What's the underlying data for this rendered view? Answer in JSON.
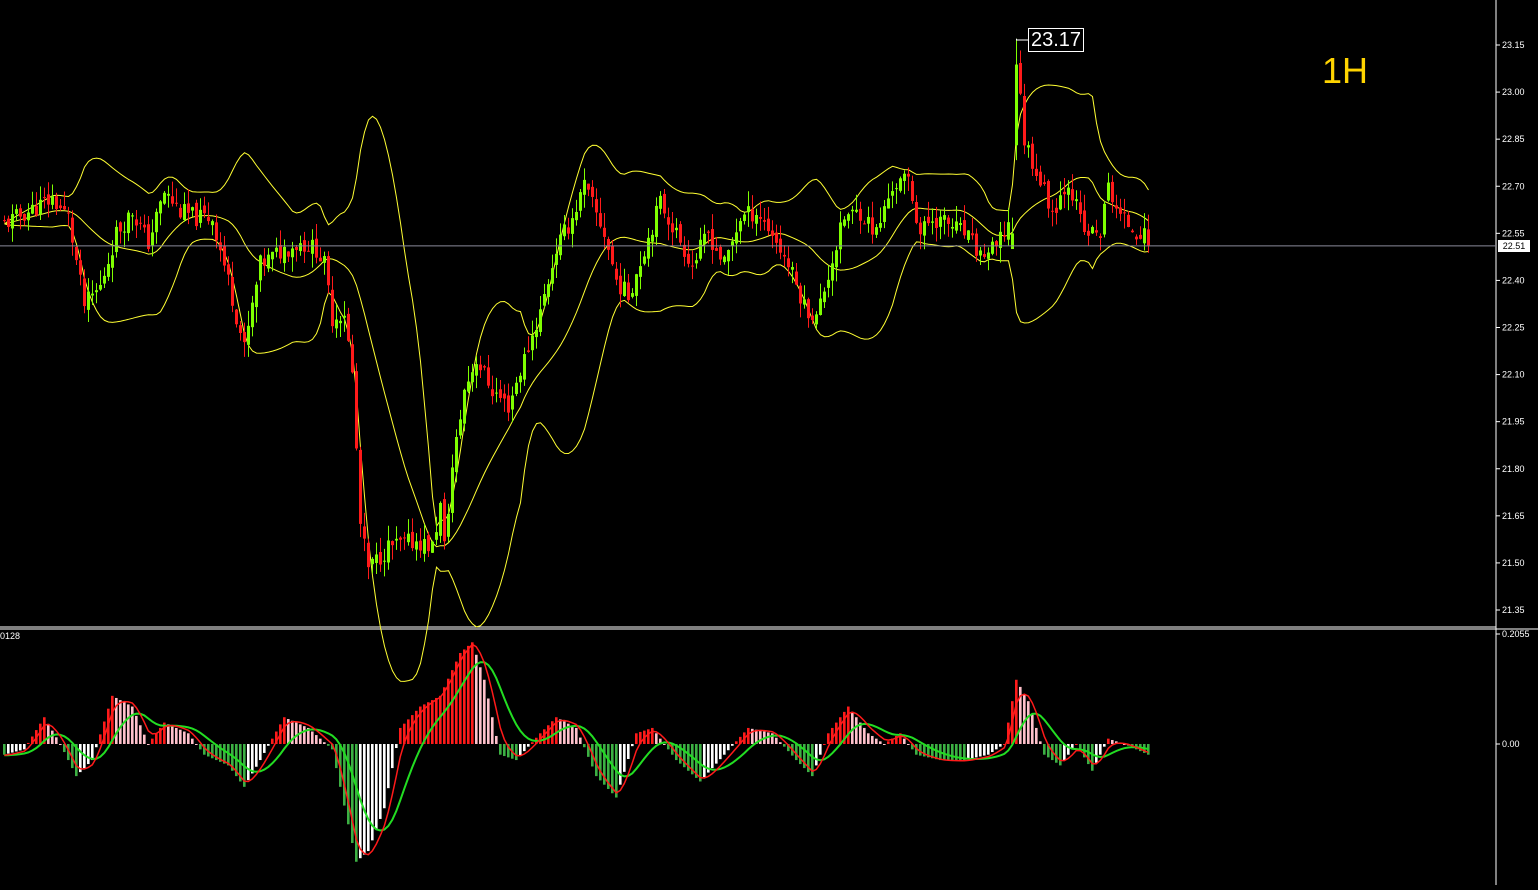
{
  "timeframe": "1H",
  "current_price": "22.51",
  "high_label": "23.17",
  "sub_window_left_label": "0128",
  "colors": {
    "background": "#000000",
    "bull": "#7fff00",
    "bear": "#ff1a1a",
    "bands": "#ffff33",
    "macd_pos_strong": "#ff1a1a",
    "macd_pos_weak": "#ffc0cb",
    "macd_neg_strong": "#3cb043",
    "macd_neg_weak": "#ffffff",
    "macd_line": "#ff1a1a",
    "signal_line": "#22dd22",
    "timeframe": "#ffd400"
  },
  "chart_data": [
    {
      "type": "candlestick",
      "title": "",
      "y_ticks": [
        "23.15",
        "23.00",
        "22.85",
        "22.70",
        "22.55",
        "22.40",
        "22.25",
        "22.10",
        "21.95",
        "21.80",
        "21.65",
        "21.50",
        "21.35"
      ],
      "ylim": [
        21.3,
        23.25
      ],
      "current_price": 22.51,
      "high_annotation": 23.17,
      "overlays": [
        "bollinger upper",
        "bollinger middle",
        "bollinger lower"
      ],
      "close_path": [
        {
          "bar": 0,
          "close": 22.58
        },
        {
          "bar": 6,
          "close": 22.62
        },
        {
          "bar": 12,
          "close": 22.66
        },
        {
          "bar": 16,
          "close": 22.6
        },
        {
          "bar": 20,
          "close": 22.32
        },
        {
          "bar": 24,
          "close": 22.38
        },
        {
          "bar": 28,
          "close": 22.55
        },
        {
          "bar": 32,
          "close": 22.62
        },
        {
          "bar": 36,
          "close": 22.52
        },
        {
          "bar": 40,
          "close": 22.68
        },
        {
          "bar": 44,
          "close": 22.62
        },
        {
          "bar": 48,
          "close": 22.6
        },
        {
          "bar": 52,
          "close": 22.6
        },
        {
          "bar": 56,
          "close": 22.4
        },
        {
          "bar": 60,
          "close": 22.18
        },
        {
          "bar": 64,
          "close": 22.45
        },
        {
          "bar": 70,
          "close": 22.5
        },
        {
          "bar": 74,
          "close": 22.52
        },
        {
          "bar": 78,
          "close": 22.5
        },
        {
          "bar": 80,
          "close": 22.45
        },
        {
          "bar": 82,
          "close": 22.28
        },
        {
          "bar": 85,
          "close": 22.3
        },
        {
          "bar": 87,
          "close": 22.1
        },
        {
          "bar": 89,
          "close": 21.62
        },
        {
          "bar": 91,
          "close": 21.48
        },
        {
          "bar": 96,
          "close": 21.55
        },
        {
          "bar": 103,
          "close": 21.57
        },
        {
          "bar": 107,
          "close": 21.55
        },
        {
          "bar": 109,
          "close": 21.68
        },
        {
          "bar": 110,
          "close": 21.55
        },
        {
          "bar": 112,
          "close": 21.8
        },
        {
          "bar": 115,
          "close": 22.05
        },
        {
          "bar": 118,
          "close": 22.15
        },
        {
          "bar": 122,
          "close": 22.05
        },
        {
          "bar": 126,
          "close": 22.0
        },
        {
          "bar": 130,
          "close": 22.15
        },
        {
          "bar": 134,
          "close": 22.3
        },
        {
          "bar": 138,
          "close": 22.5
        },
        {
          "bar": 142,
          "close": 22.6
        },
        {
          "bar": 145,
          "close": 22.7
        },
        {
          "bar": 150,
          "close": 22.55
        },
        {
          "bar": 153,
          "close": 22.4
        },
        {
          "bar": 156,
          "close": 22.35
        },
        {
          "bar": 160,
          "close": 22.5
        },
        {
          "bar": 164,
          "close": 22.65
        },
        {
          "bar": 168,
          "close": 22.55
        },
        {
          "bar": 172,
          "close": 22.45
        },
        {
          "bar": 176,
          "close": 22.55
        },
        {
          "bar": 180,
          "close": 22.45
        },
        {
          "bar": 184,
          "close": 22.6
        },
        {
          "bar": 188,
          "close": 22.62
        },
        {
          "bar": 192,
          "close": 22.55
        },
        {
          "bar": 196,
          "close": 22.45
        },
        {
          "bar": 200,
          "close": 22.32
        },
        {
          "bar": 203,
          "close": 22.28
        },
        {
          "bar": 206,
          "close": 22.42
        },
        {
          "bar": 210,
          "close": 22.6
        },
        {
          "bar": 214,
          "close": 22.62
        },
        {
          "bar": 218,
          "close": 22.55
        },
        {
          "bar": 222,
          "close": 22.7
        },
        {
          "bar": 226,
          "close": 22.72
        },
        {
          "bar": 229,
          "close": 22.55
        },
        {
          "bar": 232,
          "close": 22.6
        },
        {
          "bar": 236,
          "close": 22.58
        },
        {
          "bar": 240,
          "close": 22.55
        },
        {
          "bar": 244,
          "close": 22.48
        },
        {
          "bar": 248,
          "close": 22.5
        },
        {
          "bar": 251,
          "close": 22.58
        },
        {
          "bar": 253,
          "close": 23.1
        },
        {
          "bar": 255,
          "close": 22.85
        },
        {
          "bar": 258,
          "close": 22.75
        },
        {
          "bar": 262,
          "close": 22.62
        },
        {
          "bar": 266,
          "close": 22.72
        },
        {
          "bar": 270,
          "close": 22.55
        },
        {
          "bar": 274,
          "close": 22.55
        },
        {
          "bar": 276,
          "close": 22.7
        },
        {
          "bar": 279,
          "close": 22.6
        },
        {
          "bar": 283,
          "close": 22.56
        },
        {
          "bar": 286,
          "close": 22.53
        }
      ]
    },
    {
      "type": "macd",
      "title": "",
      "y_ticks": [
        "0.2055",
        "0.00"
      ],
      "ylim": [
        -0.42,
        0.2055
      ],
      "series": [
        {
          "name": "",
          "kind": "histogram"
        },
        {
          "name": "",
          "kind": "line",
          "color": "#ff1a1a"
        },
        {
          "name": "",
          "kind": "line",
          "color": "#22dd22"
        }
      ],
      "histogram_path": [
        {
          "bar": 0,
          "value": -0.02
        },
        {
          "bar": 5,
          "value": -0.01
        },
        {
          "bar": 10,
          "value": 0.05
        },
        {
          "bar": 14,
          "value": 0.0
        },
        {
          "bar": 18,
          "value": -0.06
        },
        {
          "bar": 22,
          "value": -0.03
        },
        {
          "bar": 27,
          "value": 0.09
        },
        {
          "bar": 32,
          "value": 0.07
        },
        {
          "bar": 36,
          "value": 0.0
        },
        {
          "bar": 40,
          "value": 0.04
        },
        {
          "bar": 46,
          "value": 0.02
        },
        {
          "bar": 50,
          "value": -0.02
        },
        {
          "bar": 56,
          "value": -0.04
        },
        {
          "bar": 60,
          "value": -0.08
        },
        {
          "bar": 64,
          "value": -0.03
        },
        {
          "bar": 70,
          "value": 0.05
        },
        {
          "bar": 76,
          "value": 0.03
        },
        {
          "bar": 82,
          "value": -0.01
        },
        {
          "bar": 86,
          "value": -0.15
        },
        {
          "bar": 88,
          "value": -0.22
        },
        {
          "bar": 91,
          "value": -0.2
        },
        {
          "bar": 95,
          "value": -0.12
        },
        {
          "bar": 99,
          "value": 0.03
        },
        {
          "bar": 104,
          "value": 0.07
        },
        {
          "bar": 109,
          "value": 0.09
        },
        {
          "bar": 114,
          "value": 0.17
        },
        {
          "bar": 117,
          "value": 0.19
        },
        {
          "bar": 120,
          "value": 0.12
        },
        {
          "bar": 124,
          "value": -0.02
        },
        {
          "bar": 128,
          "value": -0.03
        },
        {
          "bar": 134,
          "value": 0.02
        },
        {
          "bar": 138,
          "value": 0.05
        },
        {
          "bar": 143,
          "value": 0.03
        },
        {
          "bar": 148,
          "value": -0.06
        },
        {
          "bar": 153,
          "value": -0.1
        },
        {
          "bar": 158,
          "value": 0.02
        },
        {
          "bar": 162,
          "value": 0.03
        },
        {
          "bar": 168,
          "value": -0.03
        },
        {
          "bar": 174,
          "value": -0.07
        },
        {
          "bar": 180,
          "value": -0.02
        },
        {
          "bar": 186,
          "value": 0.03
        },
        {
          "bar": 192,
          "value": 0.02
        },
        {
          "bar": 198,
          "value": -0.03
        },
        {
          "bar": 202,
          "value": -0.06
        },
        {
          "bar": 206,
          "value": 0.02
        },
        {
          "bar": 211,
          "value": 0.07
        },
        {
          "bar": 216,
          "value": 0.02
        },
        {
          "bar": 220,
          "value": 0.0
        },
        {
          "bar": 224,
          "value": 0.02
        },
        {
          "bar": 228,
          "value": -0.02
        },
        {
          "bar": 234,
          "value": -0.03
        },
        {
          "bar": 240,
          "value": -0.03
        },
        {
          "bar": 246,
          "value": -0.02
        },
        {
          "bar": 250,
          "value": 0.0
        },
        {
          "bar": 253,
          "value": 0.12
        },
        {
          "bar": 256,
          "value": 0.08
        },
        {
          "bar": 260,
          "value": -0.02
        },
        {
          "bar": 264,
          "value": -0.04
        },
        {
          "bar": 268,
          "value": 0.0
        },
        {
          "bar": 272,
          "value": -0.05
        },
        {
          "bar": 276,
          "value": 0.01
        },
        {
          "bar": 280,
          "value": 0.0
        },
        {
          "bar": 286,
          "value": -0.02
        }
      ]
    }
  ]
}
